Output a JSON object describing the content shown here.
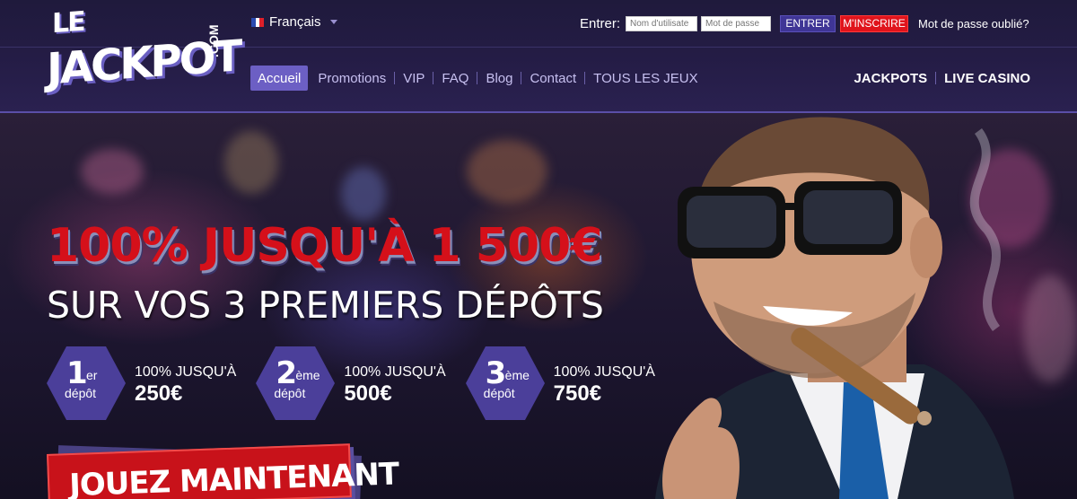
{
  "brand": {
    "le": "LE",
    "jackpot": "JACKPOT",
    "com": ".COM"
  },
  "language": {
    "selected": "Français"
  },
  "login": {
    "label": "Entrer:",
    "username_placeholder": "Nom d'utilisate",
    "password_placeholder": "Mot de passe",
    "enter_button": "ENTRER",
    "register_button": "M'INSCRIRE",
    "forgot_link": "Mot de passe oublié?"
  },
  "nav": {
    "items": [
      {
        "label": "Accueil",
        "active": true
      },
      {
        "label": "Promotions"
      },
      {
        "label": "VIP"
      },
      {
        "label": "FAQ"
      },
      {
        "label": "Blog"
      },
      {
        "label": "Contact"
      },
      {
        "label": "TOUS LES JEUX"
      }
    ],
    "right": [
      {
        "label": "JACKPOTS"
      },
      {
        "label": "LIVE CASINO"
      }
    ]
  },
  "hero": {
    "headline": "100% JUSQU'À 1 500€",
    "subline": "SUR VOS 3 PREMIERS DÉPÔTS",
    "deposits": [
      {
        "num": "1",
        "sup": "er",
        "dep": "dépôt",
        "line1": "100% JUSQU'À",
        "amount": "250€"
      },
      {
        "num": "2",
        "sup": "ème",
        "dep": "dépôt",
        "line1": "100% JUSQU'À",
        "amount": "500€"
      },
      {
        "num": "3",
        "sup": "ème",
        "dep": "dépôt",
        "line1": "100% JUSQU'À",
        "amount": "750€"
      }
    ],
    "cta": "JOUEZ MAINTENANT"
  },
  "colors": {
    "accent": "#6c5fc4",
    "red": "#d5101a",
    "header_bg": "#241c45"
  }
}
